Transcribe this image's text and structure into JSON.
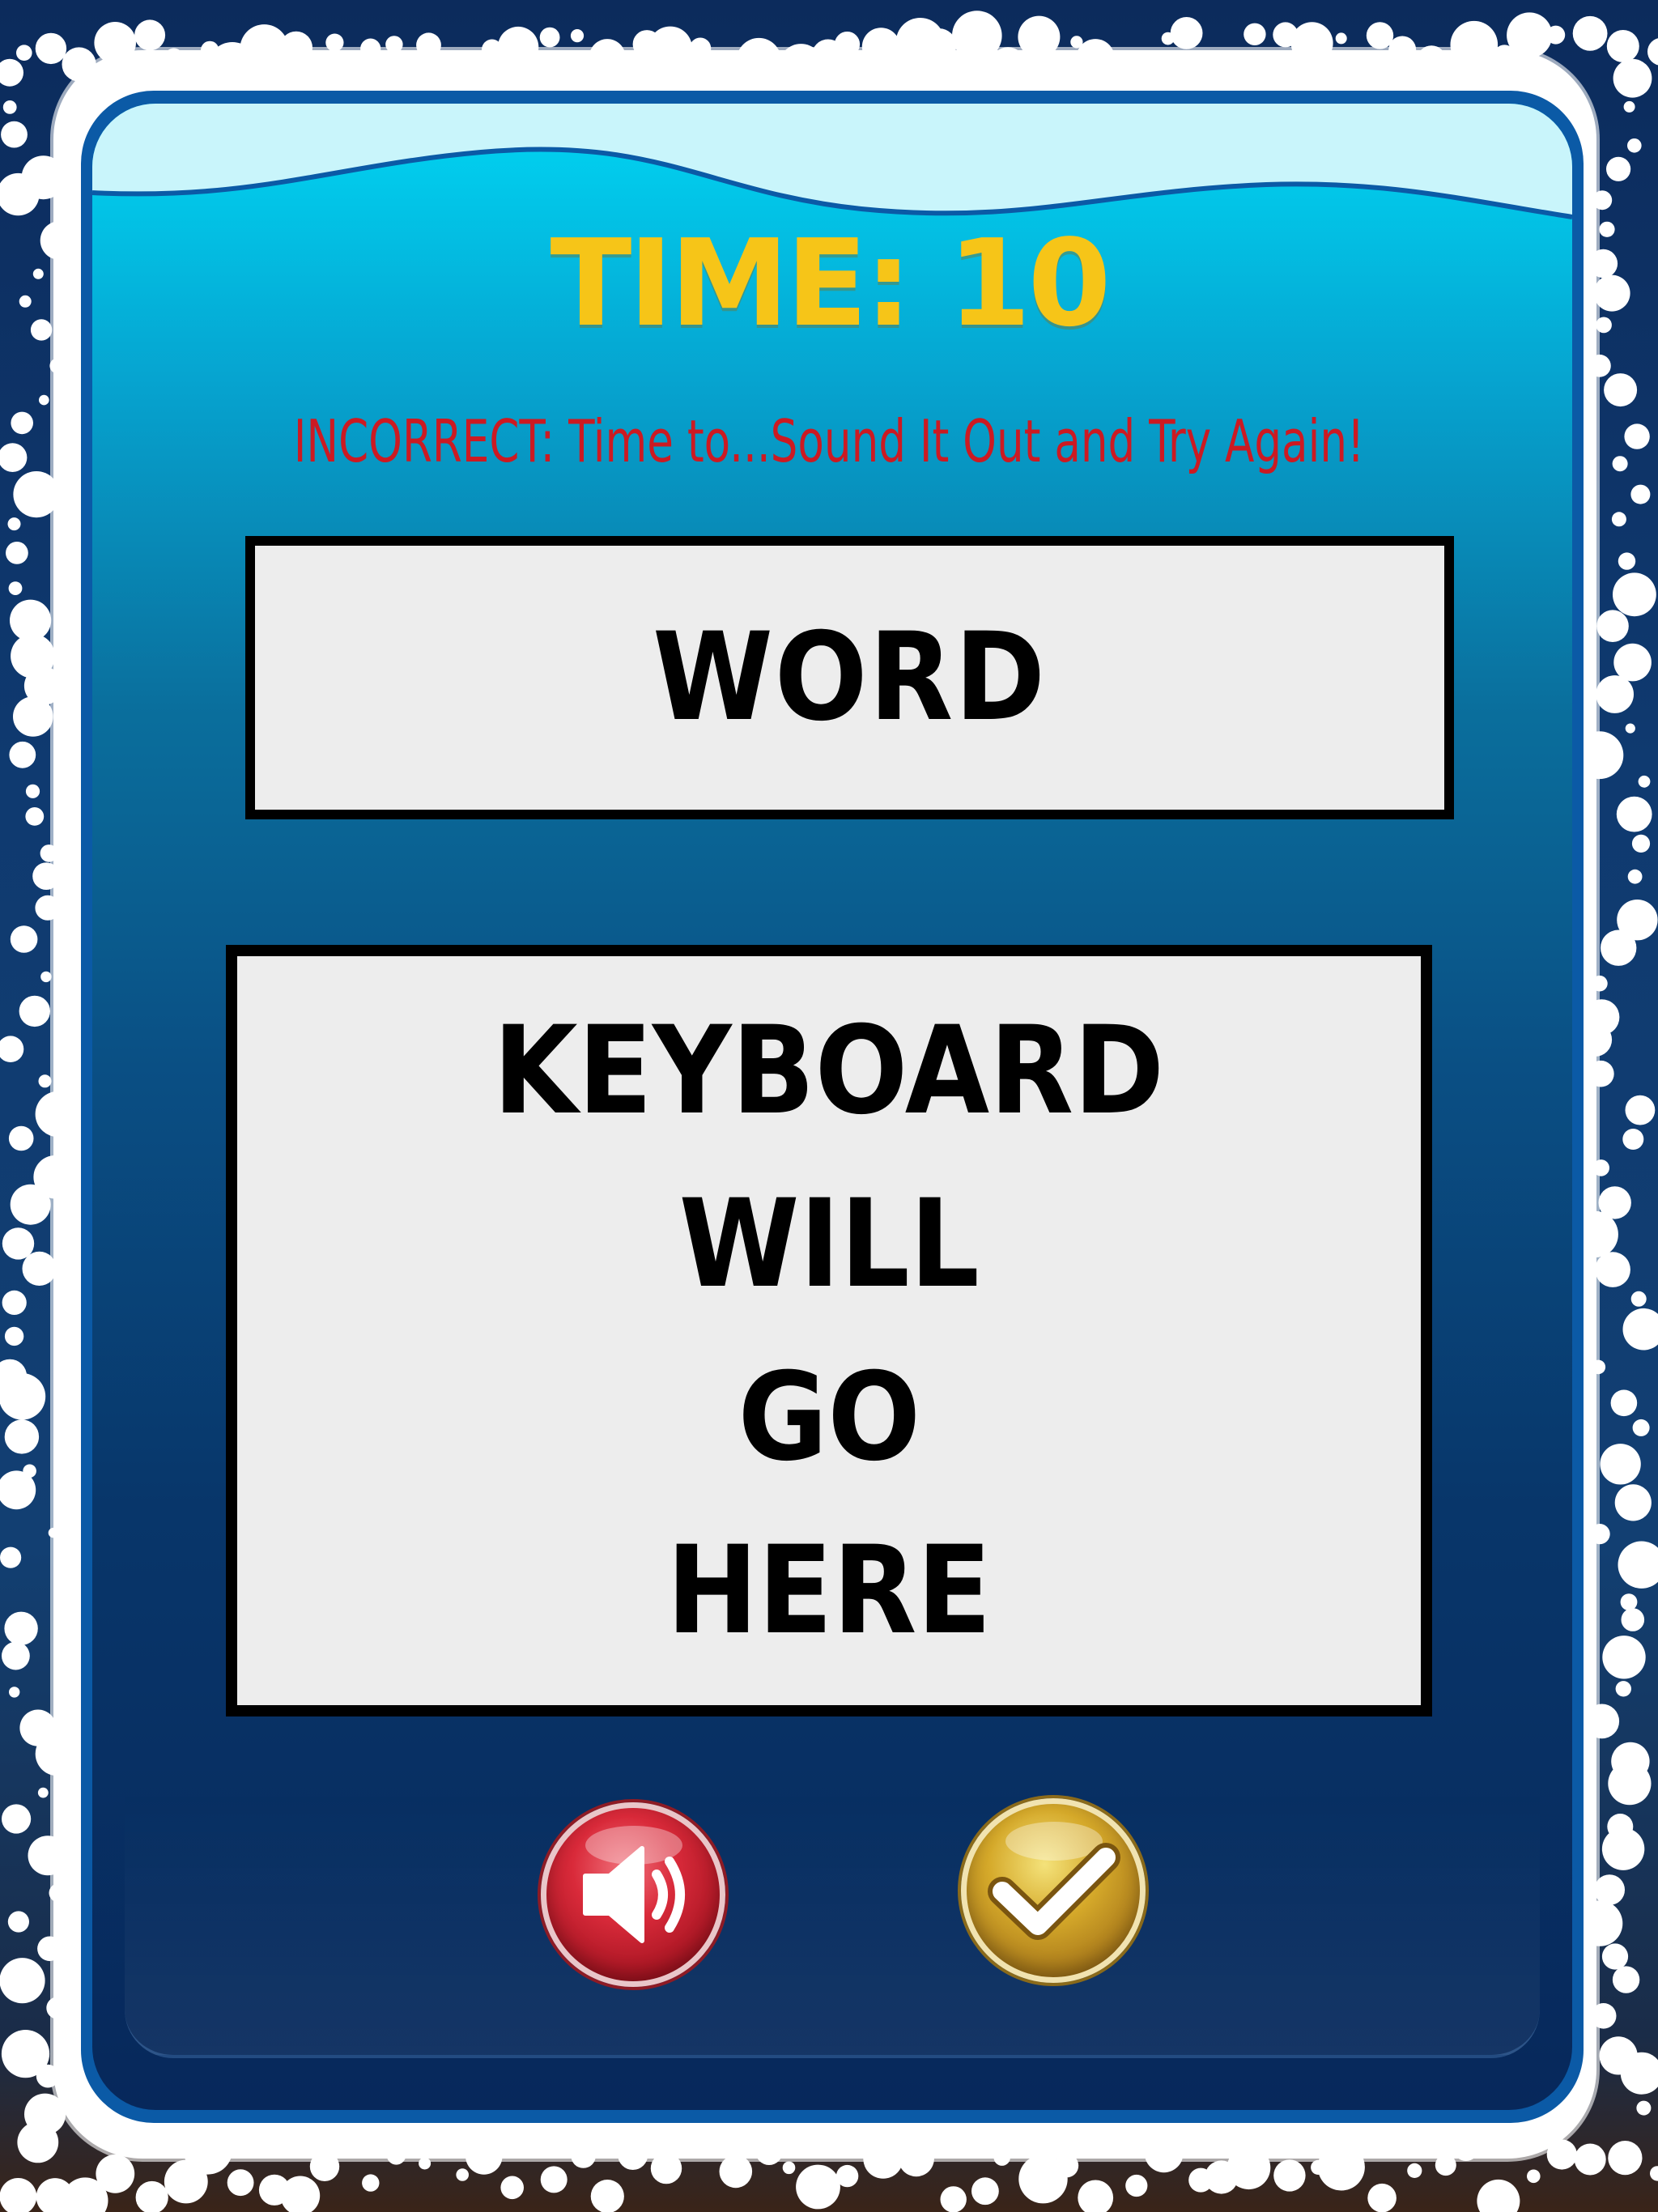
{
  "game": {
    "timer_text": "TIME: 10",
    "feedback_message": "INCORRECT: Time to...Sound It Out and Try Again!",
    "word_box_text": "WORD",
    "keyboard_placeholder_lines": [
      "KEYBOARD",
      "WILL",
      "GO",
      "HERE"
    ]
  },
  "buttons": {
    "sound": {
      "icon": "speaker-icon",
      "color": "#d92a3a"
    },
    "submit": {
      "icon": "checkmark-icon",
      "color": "#d5a92a"
    }
  },
  "colors": {
    "timer": "#f6c518",
    "feedback": "#cc1a22",
    "panel_top": "#00d6f4",
    "panel_bottom": "#07285b",
    "background": "#0c2b5c",
    "frame": "#ffffff",
    "box_fill": "#ededed"
  }
}
